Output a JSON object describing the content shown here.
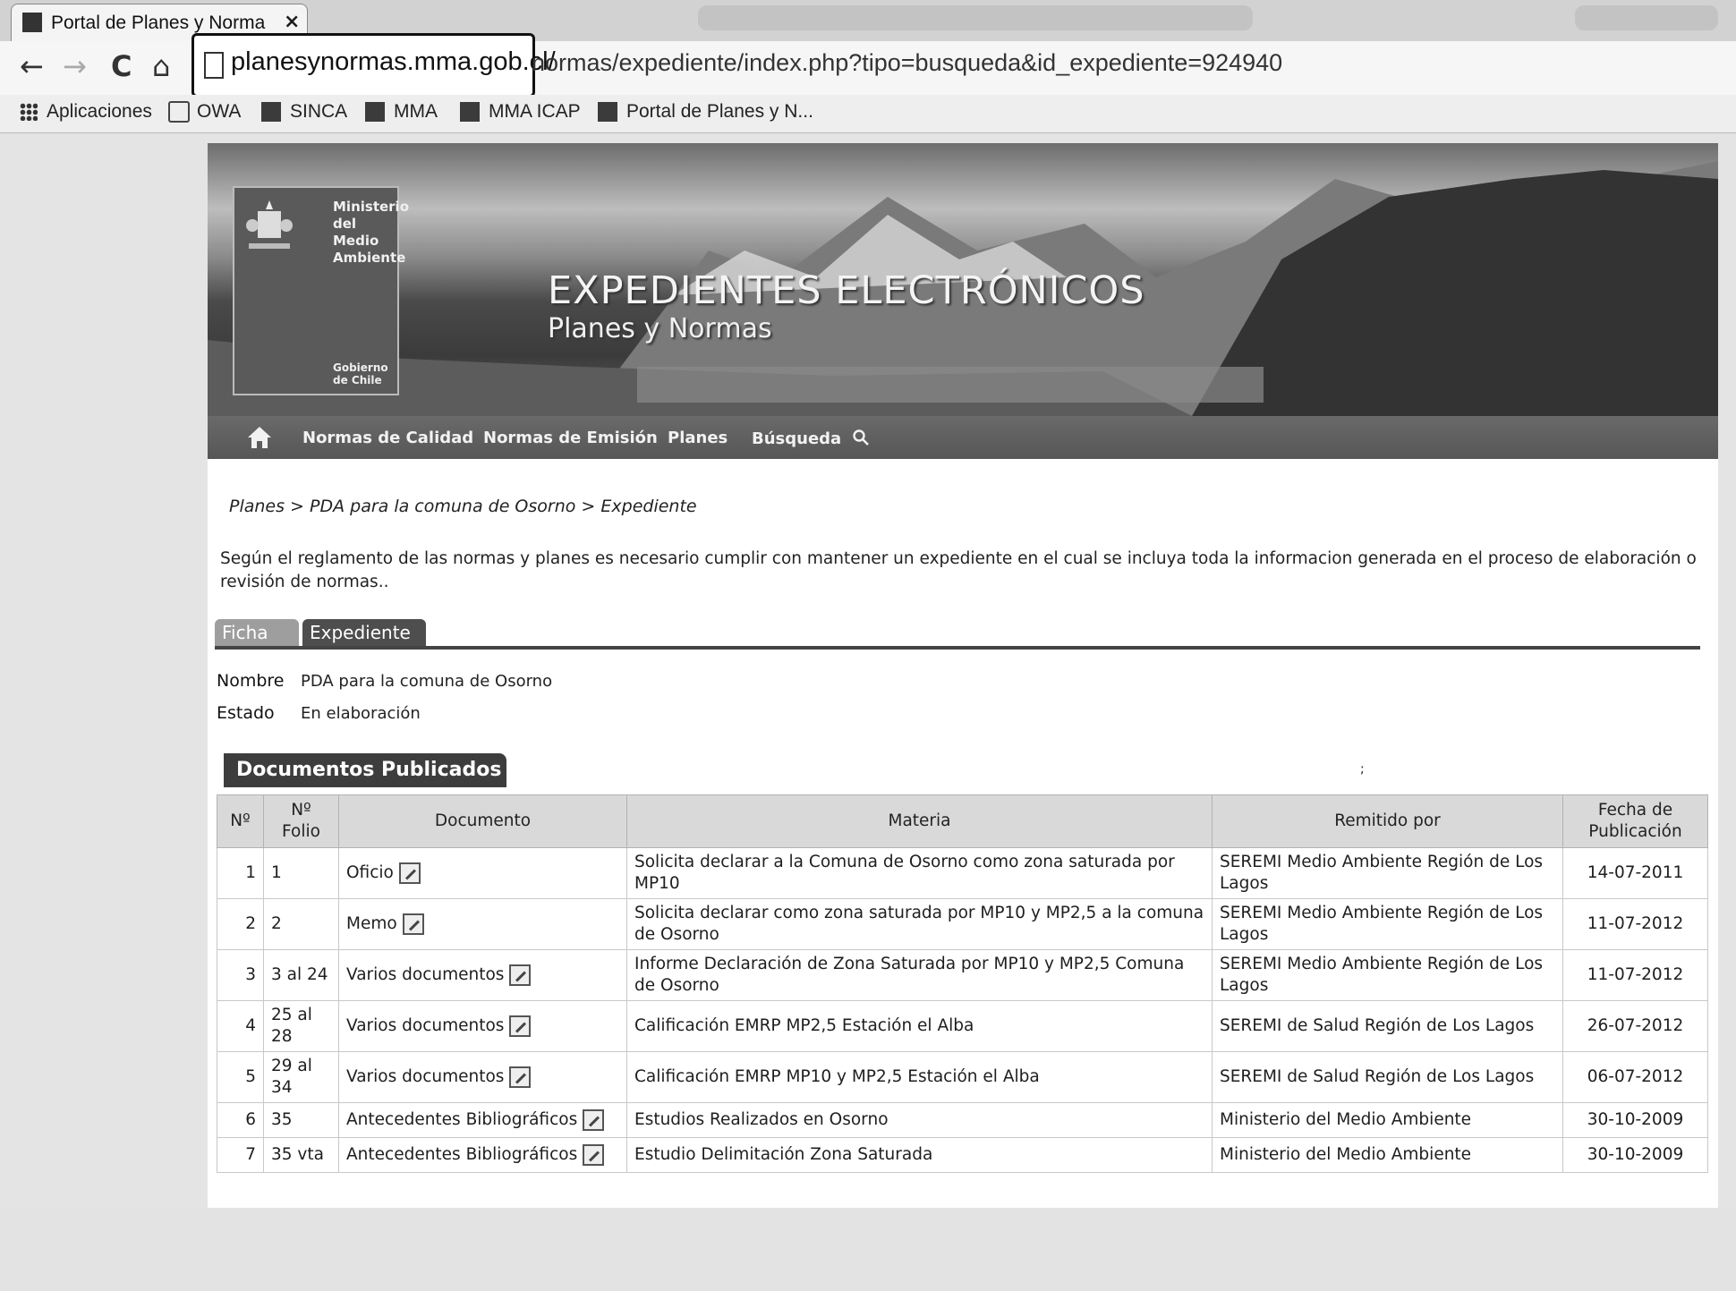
{
  "browser": {
    "tab_title": "Portal de Planes y Norma:",
    "tab_close": "×",
    "url_host": "planesynormas.mma.gob.cl/",
    "url_path": "normas/expediente/index.php?tipo=busqueda&id_expediente=924940",
    "nav": {
      "back": "←",
      "forward": "→",
      "reload": "C",
      "home": "⌂"
    },
    "bookmarks": [
      "Aplicaciones",
      "OWA",
      "SINCA",
      "MMA",
      "MMA ICAP",
      "Portal de Planes y N..."
    ]
  },
  "site": {
    "logo_lines": [
      "Ministerio del",
      "Medio",
      "Ambiente"
    ],
    "logo_footer": "Gobierno de Chile",
    "banner_title": "EXPEDIENTES ELECTRÓNICOS",
    "banner_subtitle": "Planes y Normas",
    "menu": [
      "Normas de Calidad",
      "Normas de Emisión",
      "Planes",
      "Búsqueda"
    ]
  },
  "page": {
    "breadcrumb": "Planes > PDA para la comuna de Osorno > Expediente",
    "intro": "Según el reglamento de las normas y planes es necesario cumplir con mantener un expediente en el cual se incluya toda la informacion generada en el proceso de elaboración o revisión de normas..",
    "tabs": [
      "Ficha",
      "Expediente"
    ],
    "fields": [
      {
        "label": "Nombre",
        "value": "PDA para la comuna de Osorno"
      },
      {
        "label": "Estado",
        "value": "En elaboración"
      }
    ],
    "documents_title": "Documentos Publicados",
    "table": {
      "headers": [
        "Nº",
        "Nº Folio",
        "Documento",
        "Materia",
        "Remitido por",
        "Fecha de Publicación"
      ],
      "rows": [
        {
          "n": "1",
          "folio": "1",
          "doc": "Oficio",
          "materia": "Solicita declarar a la Comuna de Osorno como zona saturada por MP10",
          "remitido": "SEREMI Medio Ambiente Región de Los Lagos",
          "fecha": "14-07-2011"
        },
        {
          "n": "2",
          "folio": "2",
          "doc": "Memo",
          "materia": "Solicita declarar como zona saturada por MP10 y MP2,5 a la comuna de Osorno",
          "remitido": "SEREMI Medio Ambiente Región de Los Lagos",
          "fecha": "11-07-2012"
        },
        {
          "n": "3",
          "folio": "3 al 24",
          "doc": "Varios documentos",
          "materia": "Informe Declaración de Zona Saturada por MP10 y MP2,5 Comuna de Osorno",
          "remitido": "SEREMI Medio Ambiente Región de Los Lagos",
          "fecha": "11-07-2012"
        },
        {
          "n": "4",
          "folio": "25 al 28",
          "doc": "Varios documentos",
          "materia": "Calificación EMRP MP2,5 Estación el Alba",
          "remitido": "SEREMI de Salud Región de Los Lagos",
          "fecha": "26-07-2012"
        },
        {
          "n": "5",
          "folio": "29 al 34",
          "doc": "Varios documentos",
          "materia": "Calificación EMRP MP10 y MP2,5 Estación el Alba",
          "remitido": "SEREMI de Salud Región de Los Lagos",
          "fecha": "06-07-2012"
        },
        {
          "n": "6",
          "folio": "35",
          "doc": "Antecedentes Bibliográficos",
          "materia": "Estudios Realizados en Osorno",
          "remitido": "Ministerio del Medio Ambiente",
          "fecha": "30-10-2009"
        },
        {
          "n": "7",
          "folio": "35 vta",
          "doc": "Antecedentes Bibliográficos",
          "materia": "Estudio Delimitación Zona Saturada",
          "remitido": "Ministerio del Medio Ambiente",
          "fecha": "30-10-2009"
        }
      ]
    }
  }
}
